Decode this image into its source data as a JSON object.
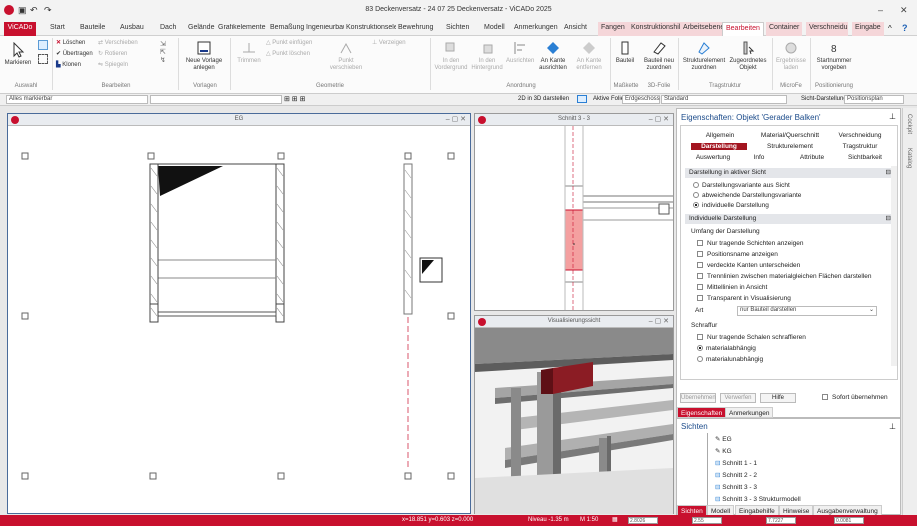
{
  "app": {
    "title": "83 Deckenversatz - 24 07 25 Deckenversatz - ViCADo 2025",
    "quick_access": [
      "save-icon",
      "undo-icon",
      "redo-icon"
    ],
    "window_controls": [
      "–",
      "✕"
    ]
  },
  "tabs": [
    {
      "label": "ViCADo"
    },
    {
      "label": "Start"
    },
    {
      "label": "Bauteile"
    },
    {
      "label": "Ausbau"
    },
    {
      "label": "Dach"
    },
    {
      "label": "Gelände"
    },
    {
      "label": "Grafikelemente"
    },
    {
      "label": "Bemaßung"
    },
    {
      "label": "Ingenieurbau"
    },
    {
      "label": "Konstruktionselemente"
    },
    {
      "label": "Bewehrung"
    },
    {
      "label": "Sichten"
    },
    {
      "label": "Modell"
    },
    {
      "label": "Anmerkungen"
    },
    {
      "label": "Ansicht"
    },
    {
      "label": "Fangen"
    },
    {
      "label": "Konstruktionshilfen"
    },
    {
      "label": "Arbeitsebene"
    },
    {
      "label": "Bearbeiten"
    },
    {
      "label": "Container"
    },
    {
      "label": "Verschneidung"
    },
    {
      "label": "Eingabe"
    }
  ],
  "ribbon": {
    "groups": [
      "Auswahl",
      "Bearbeiten",
      "Vorlagen",
      "Geometrie",
      "Anordnung",
      "Maßkette",
      "3D-Folie",
      "Tragstruktur",
      "MicroFe",
      "Positionierung"
    ],
    "buttons": {
      "markieren": "Markieren",
      "loeschen": "Löschen",
      "verschieben": "Verschieben",
      "uebertragen": "Übertragen",
      "rotieren": "Rotieren",
      "klonen": "Klonen",
      "spiegeln": "Spiegeln",
      "neue_vorlage": "Neue Vorlage anlegen",
      "trimmen": "Trimmen",
      "punkt_einfuegen": "Punkt einfügen",
      "punkt_loeschen": "Punkt löschen",
      "punkt_verschieben": "Punkt verschieben",
      "verzeigen": "Verzeigen",
      "in_den_vordergrund": "In den Vordergrund",
      "in_den_hintergrund": "In den Hintergrund",
      "ausrichten": "Ausrichten",
      "an_kante_ausrichten": "An Kante ausrichten",
      "an_kante_entfernen": "An Kante entfernen",
      "bauteil": "Bauteil",
      "bauteil_neu_zuordnen": "Bauteil neu zuordnen",
      "strukturelement_zuordnen": "Strukturelement zuordnen",
      "zugeordnetes_objekt": "Zugeordnetes Objekt",
      "ergebnisse_laden": "Ergebnisse laden",
      "startnummer_vorgeben": "Startnummer vorgeben"
    }
  },
  "toolbar": {
    "filter": "Alles markierbar",
    "show_2d_in_3d": "2D in 3D darstellen",
    "active_folder": "Aktive Folie",
    "folder_name": "Erdgeschoss",
    "standard": "Standard",
    "sicht_label": "Sicht-Darstellung",
    "sicht_value": "Positionsplan"
  },
  "views": {
    "eg": {
      "title": "EG"
    },
    "schnitt": {
      "title": "Schnitt 3 - 3"
    },
    "viz": {
      "title": "Visualisierungssicht"
    }
  },
  "properties": {
    "header": "Eigenschaften: Objekt 'Gerader Balken'",
    "tabs_row1": [
      "Allgemein",
      "Material/Querschnitt",
      "Verschneidung"
    ],
    "tabs_row2": [
      "Darstellung",
      "Strukturelement",
      "Tragstruktur"
    ],
    "tabs_row3": [
      "Auswertung",
      "Info",
      "Attribute",
      "Sichtbarkeit"
    ],
    "section1": "Darstellung in aktiver Sicht",
    "radio1": [
      "Darstellungsvariante aus Sicht",
      "abweichende Darstellungsvariante",
      "individuelle Darstellung"
    ],
    "section2": "Individuelle Darstellung",
    "umfang_label": "Umfang der Darstellung",
    "checks": [
      "Nur tragende Schichten anzeigen",
      "Positionsname anzeigen",
      "verdeckte Kanten unterscheiden",
      "Trennlinien zwischen materialgleichen Flächen darstellen",
      "Mittellinien in Ansicht",
      "Transparent in Visualisierung"
    ],
    "art_label": "Art",
    "art_value": "nur Bauteil darstellen",
    "schraffur_label": "Schraffur",
    "check_schalen": "Nur tragende Schalen schraffieren",
    "radio2": [
      "materialabhängig",
      "materialunabhängig"
    ],
    "buttons": [
      "Übernehmen",
      "Verwerfen",
      "Hilfe"
    ],
    "sofort": "Sofort übernehmen",
    "bottom_tabs": [
      "Eigenschaften",
      "Anmerkungen"
    ]
  },
  "sichten": {
    "header": "Sichten",
    "items": [
      "EG",
      "KG",
      "Schnitt 1 - 1",
      "Schnitt 2 - 2",
      "Schnitt 3 - 3",
      "Schnitt 3 - 3 Strukturmodell"
    ],
    "bottom_tabs": [
      "Sichten",
      "Modell",
      "Eingabehilfe",
      "Hinweise",
      "Ausgabenverwaltung"
    ]
  },
  "right_tabs": [
    "Cockpit",
    "Katalog"
  ],
  "status": {
    "coords": "x=18.851 y=0.603 z=0.000",
    "niveau": "Niveau -1.35 m",
    "scale": "M 1:50",
    "fields": [
      "2.8026",
      "2.55",
      "7.7227",
      "0.0081"
    ]
  },
  "colors": {
    "accent": "#c8102e",
    "beam": "#8b1c24"
  }
}
